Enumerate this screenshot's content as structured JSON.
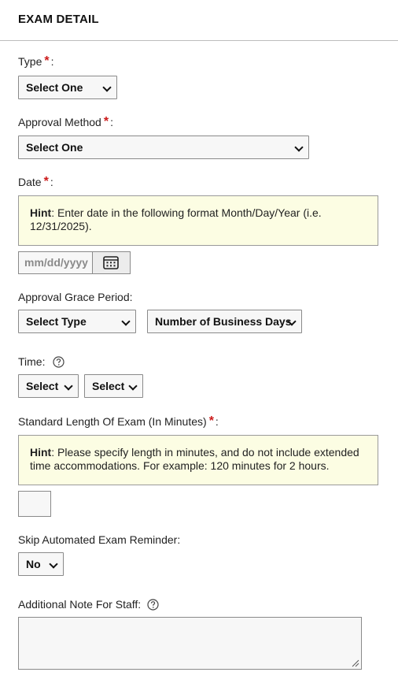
{
  "section": {
    "title": "EXAM DETAIL"
  },
  "fields": {
    "type": {
      "label": "Type",
      "value": "Select One"
    },
    "approval_method": {
      "label": "Approval Method",
      "value": "Select One"
    },
    "date": {
      "label": "Date",
      "hint_prefix": "Hint",
      "hint_text": ": Enter date in the following format Month/Day/Year (i.e. 12/31/2025).",
      "placeholder": "mm/dd/yyyy"
    },
    "grace_period": {
      "label": "Approval Grace Period:",
      "type_value": "Select Type",
      "days_value": "Number of Business Days"
    },
    "time": {
      "label": "Time:",
      "hour_value": "Select",
      "minute_value": "Select"
    },
    "length": {
      "label": "Standard Length Of Exam (In Minutes)",
      "hint_prefix": "Hint",
      "hint_text": ": Please specify length in minutes, and do not include extended time accommodations. For example: 120 minutes for 2 hours.",
      "value": ""
    },
    "skip_reminder": {
      "label": "Skip Automated Exam Reminder:",
      "value": "No"
    },
    "staff_note": {
      "label": "Additional Note For Staff:",
      "value": ""
    }
  },
  "required_marker": "*",
  "colon": ":",
  "icons": {
    "calendar": "calendar-icon",
    "help": "help-circle-icon",
    "dropdown": "chevron-down-icon",
    "resize": "resize-handle-icon"
  },
  "colors": {
    "required": "#cc1a1a",
    "hint_bg": "#fcfde3",
    "divider": "#bdbdbd"
  }
}
